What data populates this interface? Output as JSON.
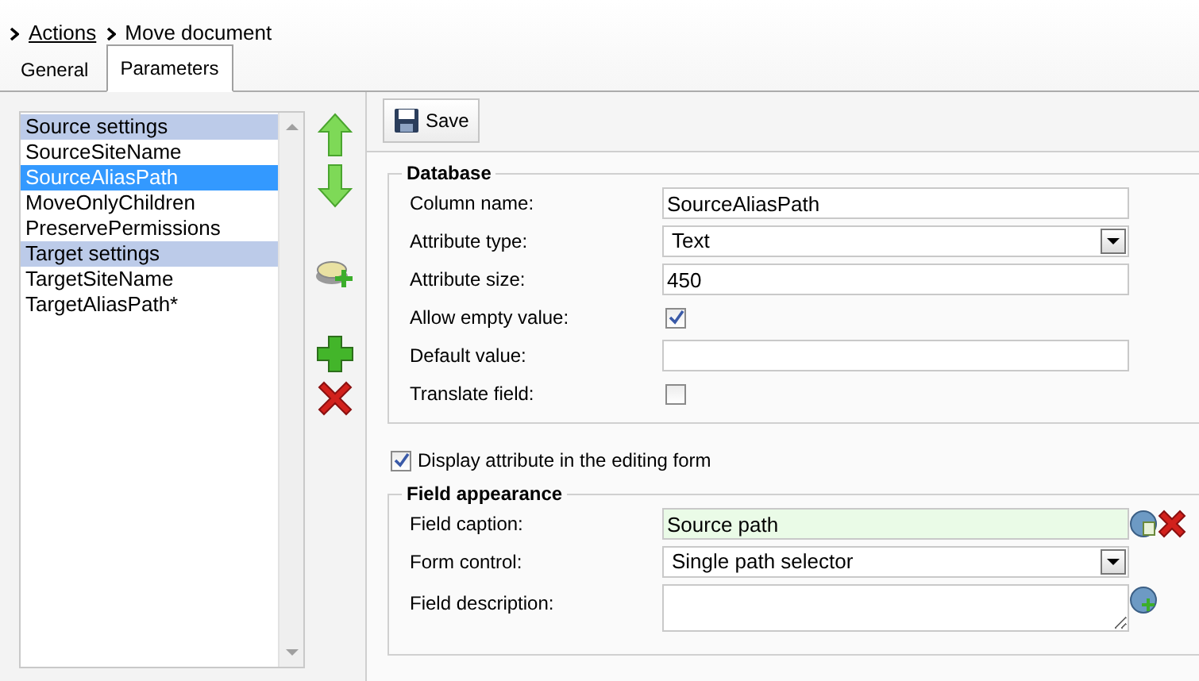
{
  "breadcrumb": [
    {
      "text": "Actions",
      "kind": "link"
    },
    {
      "text": "Move document",
      "kind": "current"
    }
  ],
  "tabs": [
    {
      "label": "General",
      "selected": false
    },
    {
      "label": "Parameters",
      "selected": true
    }
  ],
  "attribute_list": [
    {
      "text": "Source settings",
      "kind": "category",
      "selected": false
    },
    {
      "text": "SourceSiteName",
      "kind": "attribute",
      "selected": false
    },
    {
      "text": "SourceAliasPath",
      "kind": "attribute",
      "selected": true
    },
    {
      "text": "MoveOnlyChildren",
      "kind": "attribute",
      "selected": false
    },
    {
      "text": "PreservePermissions",
      "kind": "attribute",
      "selected": false
    },
    {
      "text": "Target settings",
      "kind": "category",
      "selected": false
    },
    {
      "text": "TargetSiteName",
      "kind": "attribute",
      "selected": false
    },
    {
      "text": "TargetAliasPath*",
      "kind": "attribute",
      "selected": false
    }
  ],
  "toolbar": {
    "save": "Save"
  },
  "database": {
    "legend": "Database",
    "fields": [
      {
        "label": "Column name:",
        "kind": "text",
        "value": "SourceAliasPath"
      },
      {
        "label": "Attribute type:",
        "kind": "select",
        "value": "Text"
      },
      {
        "label": "Attribute size:",
        "kind": "text",
        "value": "450"
      },
      {
        "label": "Allow empty value:",
        "kind": "checkbox",
        "checked": true
      },
      {
        "label": "Default value:",
        "kind": "text"
      },
      {
        "label": "Translate field:",
        "kind": "checkbox",
        "checked": false
      }
    ]
  },
  "display_in_form": {
    "label": "Display attribute in the editing form",
    "checked": true
  },
  "field_appearance": {
    "legend": "Field appearance",
    "fields": [
      {
        "label": "Field caption:",
        "kind": "localized",
        "value": "Source path"
      },
      {
        "label": "Form control:",
        "kind": "select",
        "value": "Single path selector"
      },
      {
        "label": "Field description:",
        "kind": "textarea"
      }
    ]
  }
}
